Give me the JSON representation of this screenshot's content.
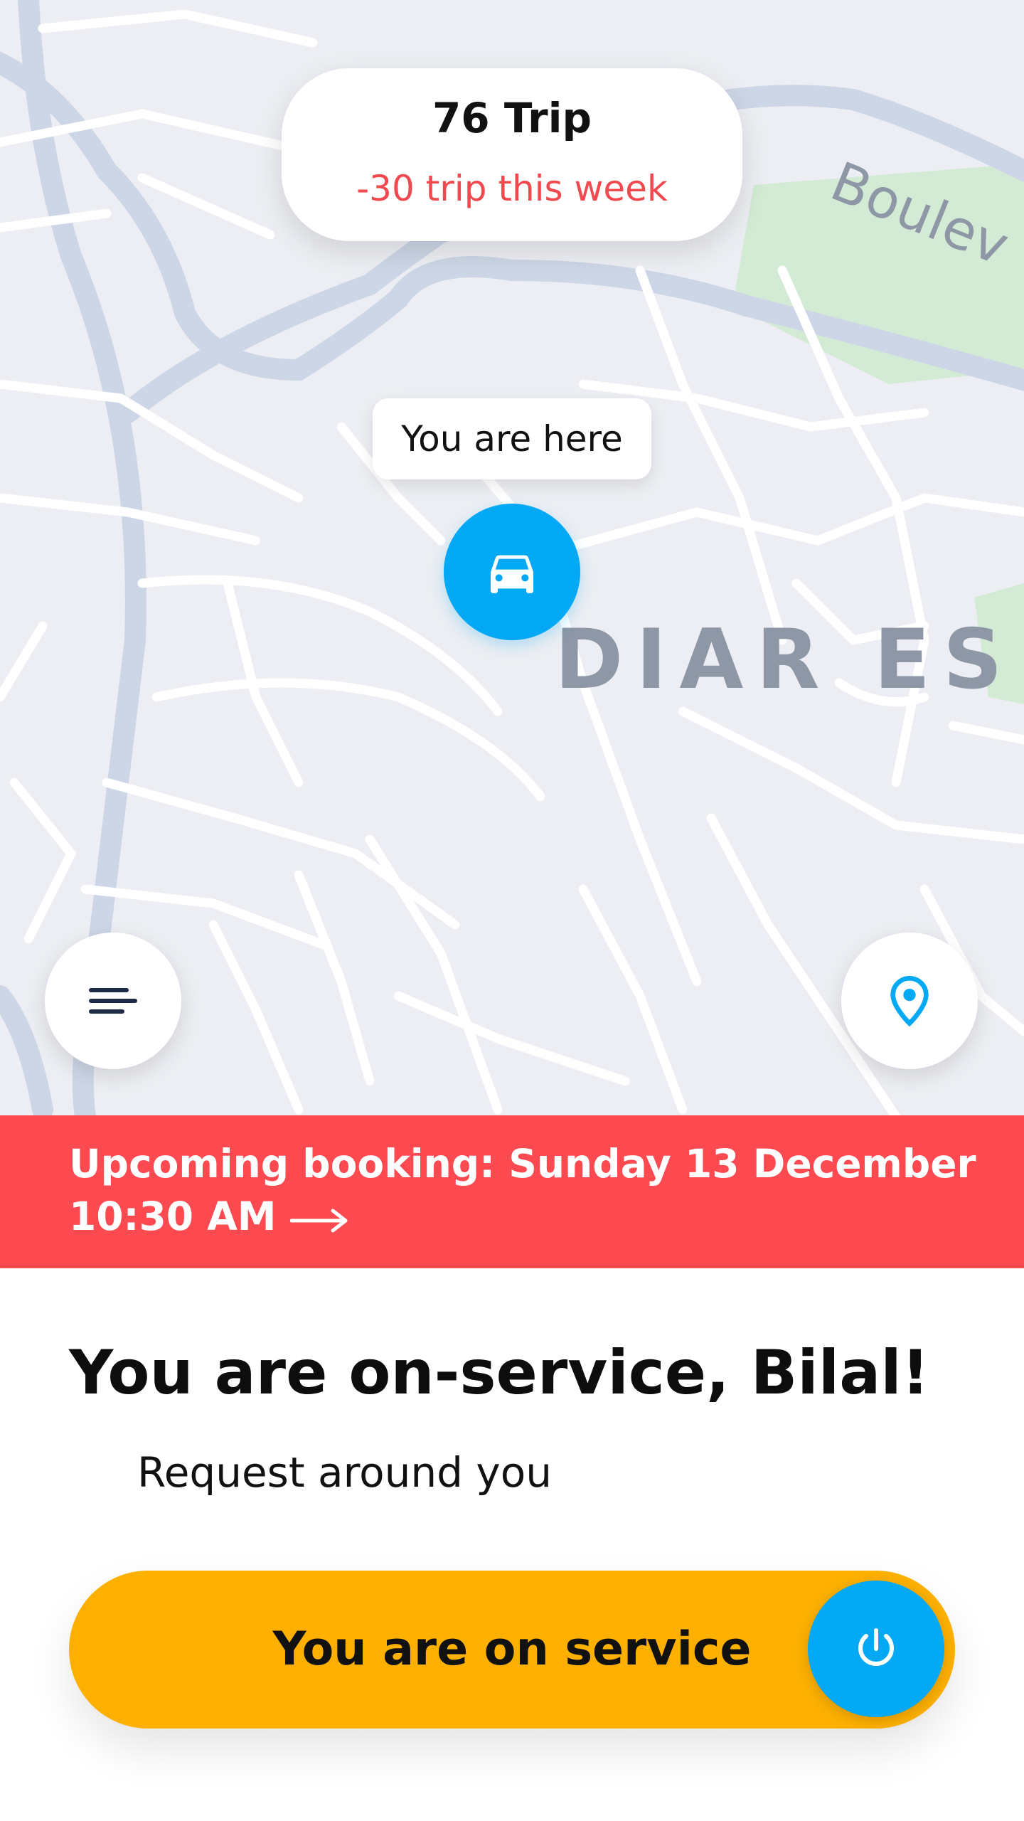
{
  "map": {
    "district_label": "DIAR ES S",
    "street_label": "Boulev",
    "marker_icon": "car-icon",
    "colors": {
      "background": "#eceef3",
      "roads": "#ffffff",
      "major_roads": "#cdd6e6",
      "park": "#d3ebd5"
    }
  },
  "trip_card": {
    "title": "76 Trip",
    "subtitle": "-30 trip this week",
    "subtitle_color": "#f04a4f"
  },
  "location_bubble": {
    "text": "You are here"
  },
  "controls": {
    "menu_icon": "menu-icon",
    "locate_icon": "location-pin-icon"
  },
  "banner": {
    "line1": "Upcoming booking: Sunday 13 December",
    "line2": "10:30 AM",
    "arrow_icon": "arrow-right-icon",
    "color": "#fd4a50"
  },
  "greeting": "You are on-service, Bilal!",
  "request_label": "Request around you",
  "service_button": {
    "label": "You are on service",
    "icon": "power-icon",
    "color": "#fdb000",
    "icon_color": "#03a9f4"
  }
}
